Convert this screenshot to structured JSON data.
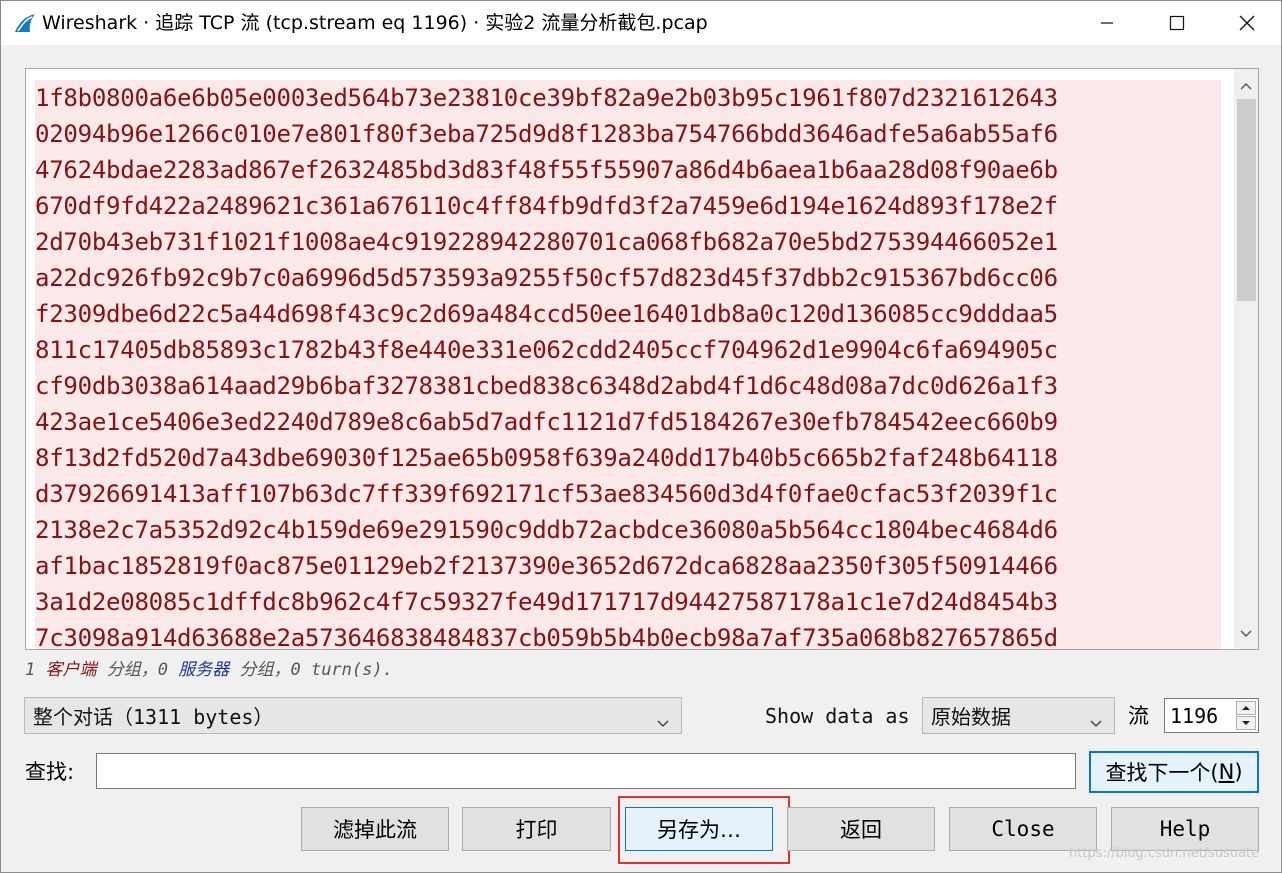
{
  "window": {
    "title": "Wireshark · 追踪 TCP 流 (tcp.stream eq 1196) · 实验2 流量分析截包.pcap",
    "controls": [
      "minimize-icon",
      "maximize-icon",
      "close-icon"
    ]
  },
  "textview": {
    "lines": [
      "1f8b0800a6e6b05e0003ed564b73e23810ce39bf82a9e2b03b95c1961f807d2321612643",
      "02094b96e1266c010e7e801f80f3eba725d9d8f1283ba754766bdd3646adfe5a6ab55af6",
      "47624bdae2283ad867ef2632485bd3d83f48f55f55907a86d4b6aea1b6aa28d08f90ae6b",
      "670df9fd422a2489621c361a676110c4ff84fb9dfd3f2a7459e6d194e1624d893f178e2f",
      "2d70b43eb731f1021f1008ae4c919228942280701ca068fb682a70e5bd275394466052e1",
      "a22dc926fb92c9b7c0a6996d5d573593a9255f50cf57d823d45f37dbb2c915367bd6cc06",
      "f2309dbe6d22c5a44d698f43c9c2d69a484ccd50ee16401db8a0c120d136085cc9dddaa5",
      "811c17405db85893c1782b43f8e440e331e062cdd2405ccf704962d1e9904c6fa694905c",
      "cf90db3038a614aad29b6baf3278381cbed838c6348d2abd4f1d6c48d08a7dc0d626a1f3",
      "423ae1ce5406e3ed2240d789e8c6ab5d7adfc1121d7fd5184267e30efb784542eec660b9",
      "8f13d2fd520d7a43dbe69030f125ae65b0958f639a240dd17b40b5c665b2faf248b64118",
      "d37926691413aff107b63dc7ff339f692171cf53ae834560d3d4f0fae0cfac53f2039f1c",
      "2138e2c7a5352d92c4b159de69e291590c9ddb72acbdce36080a5b564cc1804bec4684d6",
      "af1bac1852819f0ac875e01129eb2f2137390e3652d672dca6828aa2350f305f50914466",
      "3a1d2e08085c1dffdc8b962c4f7c59327fe49d171717d94427587178a1c1e7d24d8454b3",
      "7c3098a914d63688e2a573646838484837cb059b5b4b0ecb98a7af735a068b827657865d"
    ]
  },
  "status": {
    "client_count": "1",
    "client_label": "客户端",
    "middle": " 分组，",
    "server_count": "0",
    "server_label": "服务器",
    "tail": " 分组，0 turn(s)."
  },
  "controls": {
    "conversation_value": "整个对话（1311 bytes）",
    "show_data_as_label": "Show data as",
    "show_data_as_value": "原始数据",
    "stream_label": "流",
    "stream_value": "1196"
  },
  "find": {
    "label": "查找:",
    "value": "",
    "next_button": "查找下一个(",
    "next_accel": "N",
    "next_close": ")"
  },
  "buttons": {
    "filter_out": "滤掉此流",
    "print": "打印",
    "save_as": "另存为…",
    "back": "返回",
    "close": "Close",
    "help": "Help"
  },
  "watermark": "https://blog.csdn.net/susuate"
}
